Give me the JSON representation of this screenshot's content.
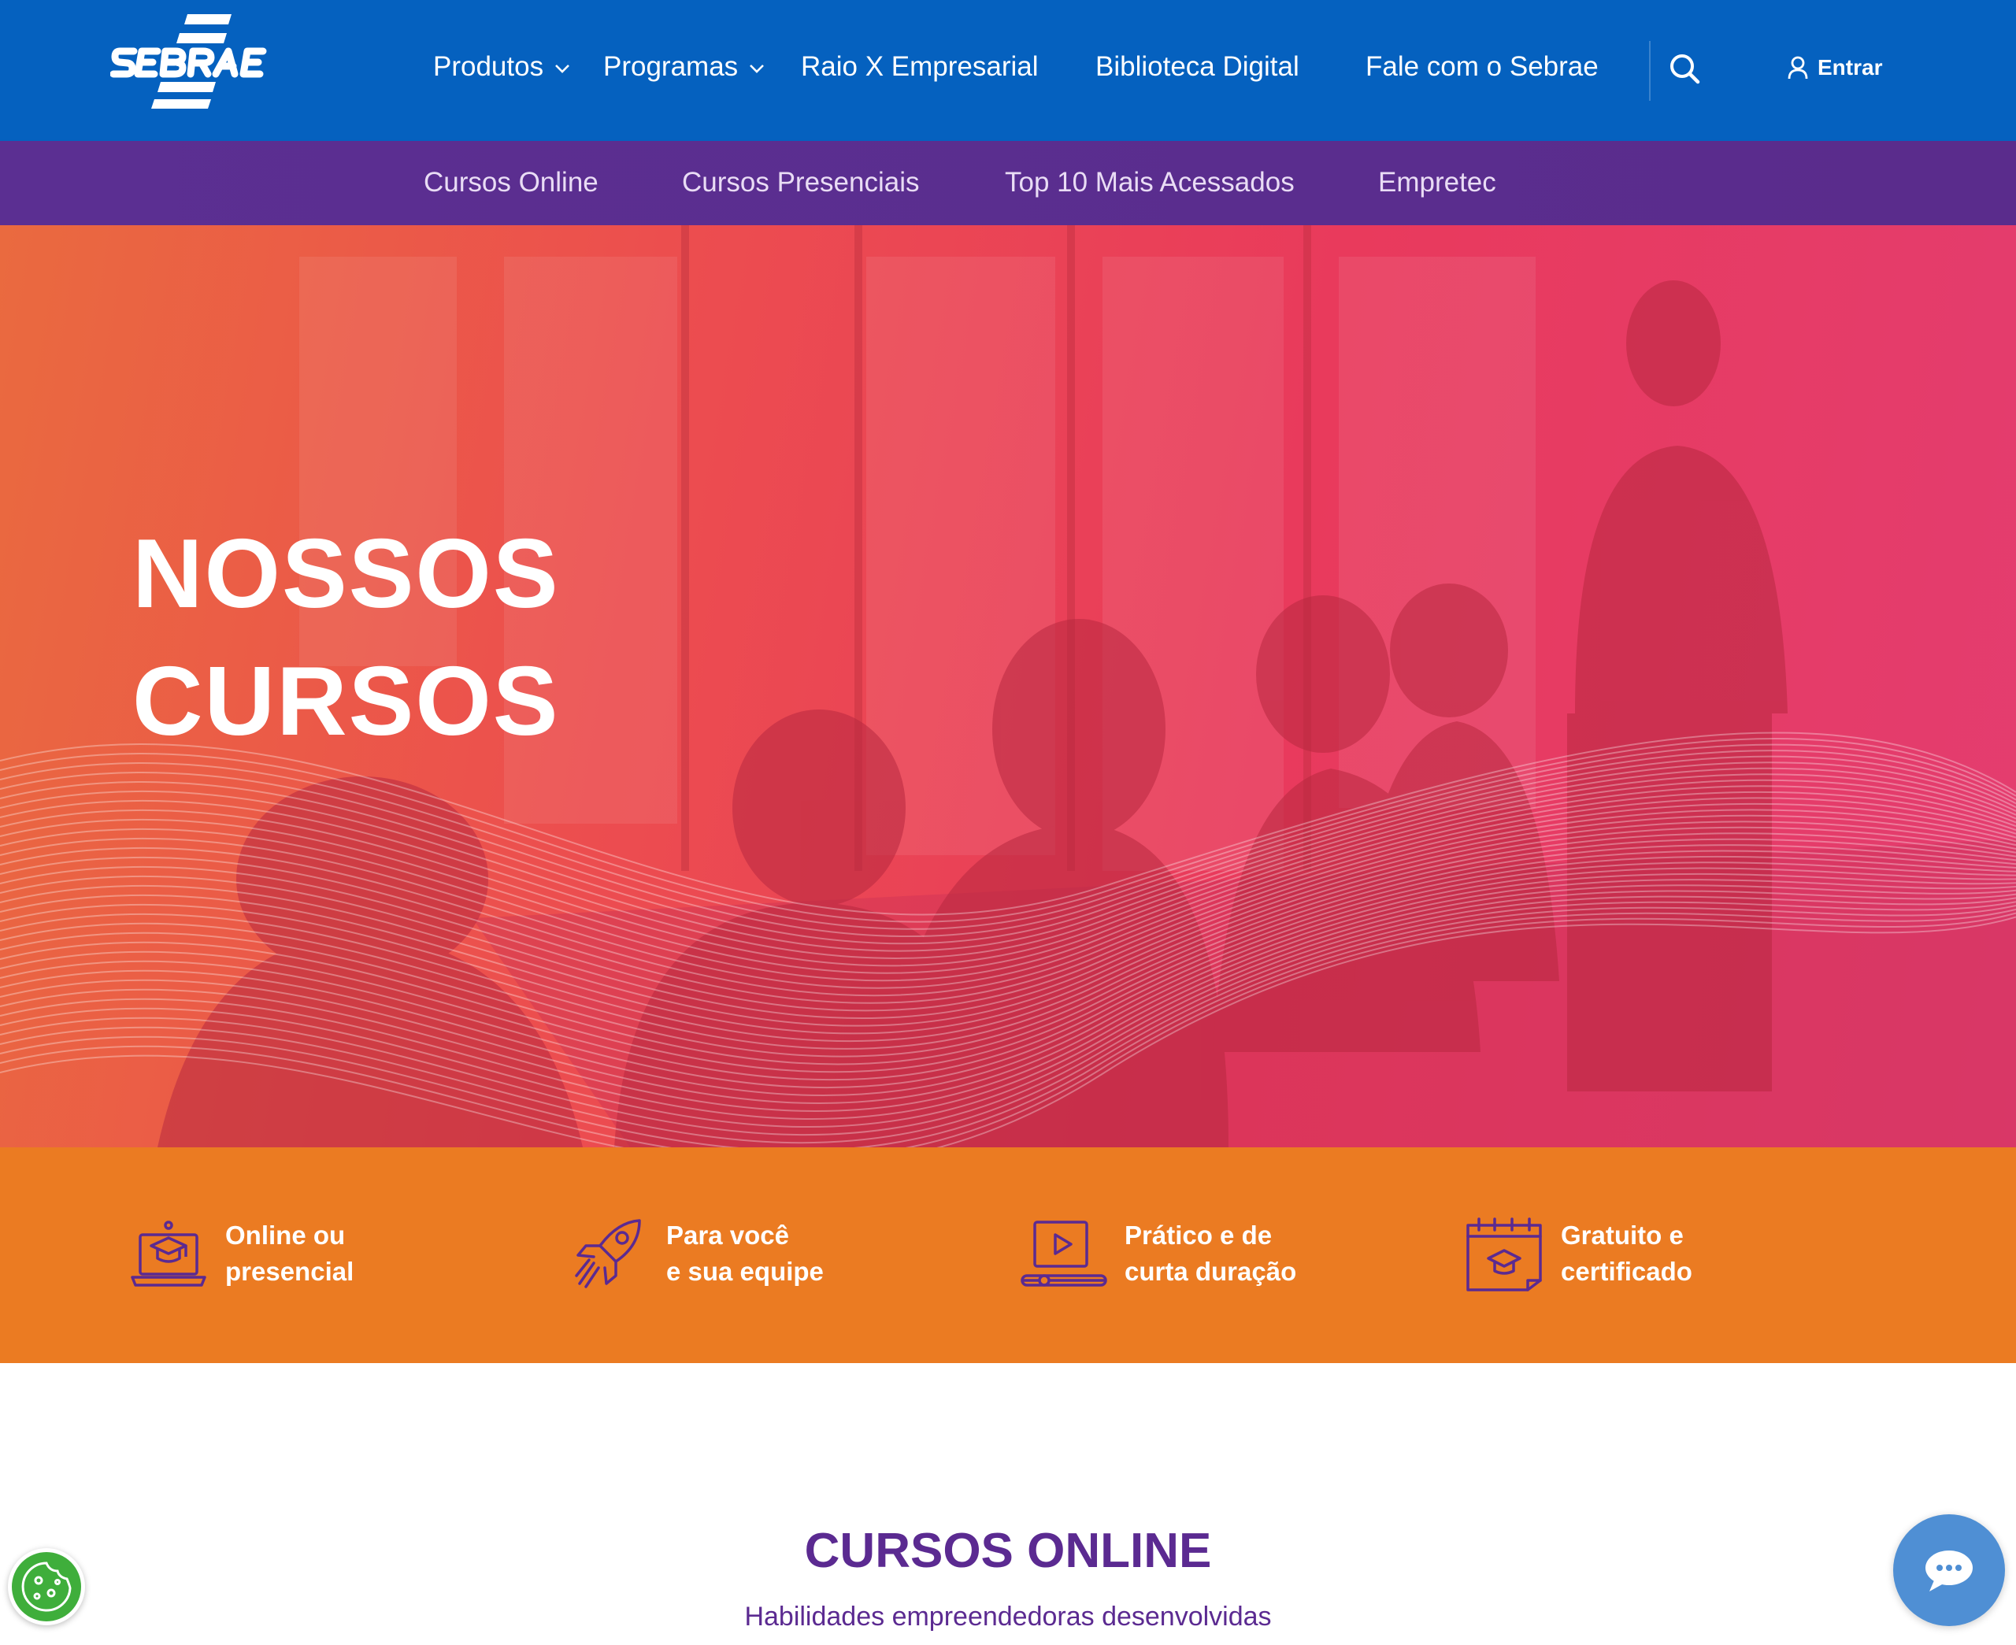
{
  "header": {
    "logo_text": "SEBRAE",
    "nav": [
      {
        "label": "Produtos",
        "has_dropdown": true
      },
      {
        "label": "Programas",
        "has_dropdown": true
      },
      {
        "label": "Raio X Empresarial",
        "has_dropdown": false
      },
      {
        "label": "Biblioteca Digital",
        "has_dropdown": false
      },
      {
        "label": "Fale com o Sebrae",
        "has_dropdown": false
      }
    ],
    "search_icon": "search-icon",
    "login_label": "Entrar",
    "login_icon": "user-icon"
  },
  "subnav": {
    "items": [
      "Cursos Online",
      "Cursos Presenciais",
      "Top 10 Mais Acessados",
      "Empretec"
    ]
  },
  "hero": {
    "title_line1": "NOSSOS",
    "title_line2": "CURSOS"
  },
  "features": [
    {
      "icon": "laptop-graduation-icon",
      "line1": "Online ou",
      "line2": "presencial"
    },
    {
      "icon": "rocket-icon",
      "line1": "Para você",
      "line2": "e sua equipe"
    },
    {
      "icon": "video-player-icon",
      "line1": "Prático e de",
      "line2": "curta duração"
    },
    {
      "icon": "certificate-calendar-icon",
      "line1": "Gratuito e",
      "line2": "certificado"
    }
  ],
  "courses": {
    "title": "CURSOS ONLINE",
    "subtitle": "Habilidades empreendedoras desenvolvidas"
  },
  "floating": {
    "cookie_icon": "cookie-icon",
    "chat_icon": "chat-icon"
  },
  "colors": {
    "topbar": "#0561bf",
    "subnav": "#5b2f92",
    "features_bar": "#eb7b22",
    "accent_purple": "#5b2a91",
    "cookie_green": "#3fae3b",
    "chat_blue": "#4f8fd4"
  }
}
